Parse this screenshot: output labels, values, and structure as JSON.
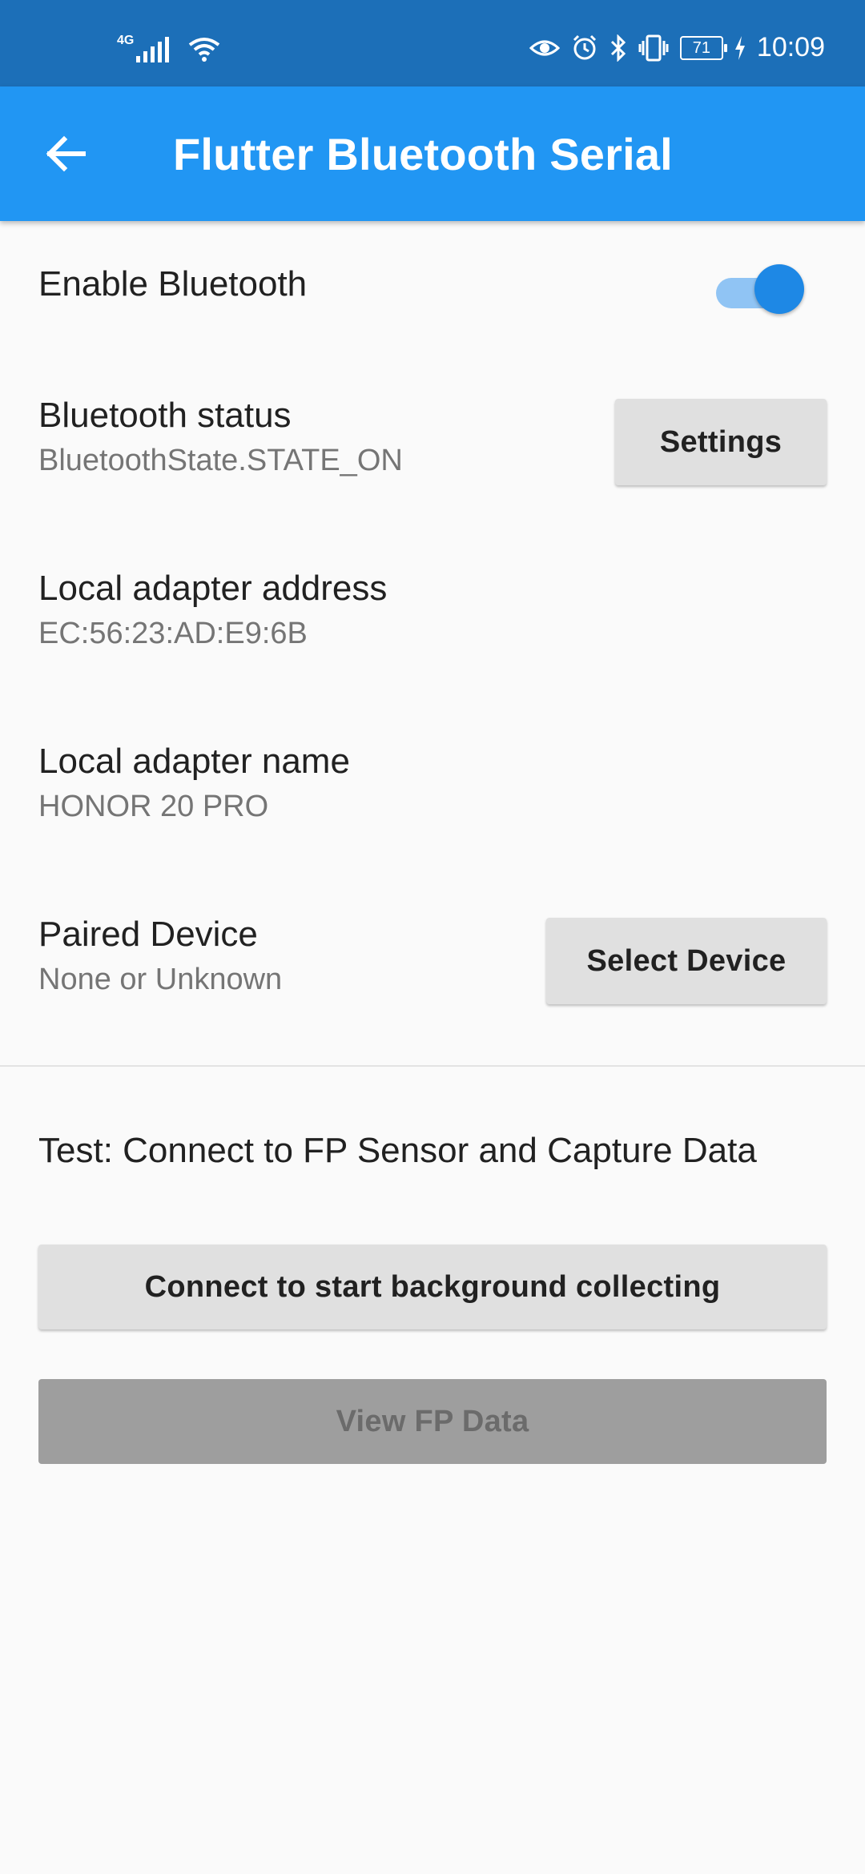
{
  "status_bar": {
    "network": "4G",
    "battery": "71",
    "time": "10:09",
    "icons": [
      "signal-icon",
      "wifi-icon",
      "eye-icon",
      "alarm-icon",
      "bluetooth-icon",
      "vibrate-icon",
      "battery-icon",
      "charging-icon"
    ]
  },
  "app_bar": {
    "title": "Flutter Bluetooth Serial",
    "color": "#2196f3"
  },
  "settings": {
    "enable_bluetooth": {
      "label": "Enable Bluetooth",
      "enabled": true
    },
    "bluetooth_status": {
      "label": "Bluetooth status",
      "value": "BluetoothState.STATE_ON",
      "button": "Settings"
    },
    "local_address": {
      "label": "Local adapter address",
      "value": "EC:56:23:AD:E9:6B"
    },
    "local_name": {
      "label": "Local adapter name",
      "value": "HONOR 20 PRO"
    },
    "paired_device": {
      "label": "Paired Device",
      "value": "None or Unknown",
      "button": "Select Device"
    }
  },
  "test": {
    "heading": "Test: Connect to FP Sensor and Capture Data",
    "connect_button": "Connect to start background collecting",
    "view_button": "View FP Data"
  }
}
